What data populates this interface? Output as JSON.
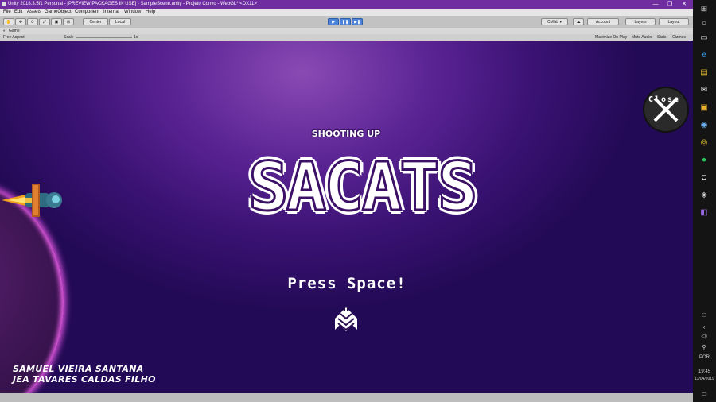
{
  "window": {
    "title": "Unity 2018.3.5f1 Personal - [PREVIEW PACKAGES IN USE] - SampleScene.unity - Projeto Convo - WebGL* <DX11>",
    "minimize": "—",
    "maximize": "❐",
    "close": "✕"
  },
  "menu": {
    "items": [
      "File",
      "Edit",
      "Assets",
      "GameObject",
      "Component",
      "Internal",
      "Window",
      "Help"
    ]
  },
  "toolbar": {
    "pivot": "Center",
    "space": "Local",
    "play": "▶",
    "pause": "❚❚",
    "step": "▶❚",
    "collab": "Collab ▾",
    "cloud": "☁",
    "account": "Account",
    "layers": "Layers",
    "layout": "Layout"
  },
  "game_panel": {
    "tab": "Game",
    "aspect": "Free Aspect",
    "scale_label": "Scale",
    "scale_value": "1x",
    "maximize_on_play": "Maximize On Play",
    "mute_audio": "Mute Audio",
    "stats": "Stats",
    "gizmos": "Gizmos"
  },
  "game": {
    "close_label": "Close",
    "subtitle": "SHOOTING UP",
    "logo": "SACATS",
    "prompt": "Press Space!",
    "credits": [
      "SAMUEL VIEIRA SANTANA",
      "JEA TAVARES CALDAS FILHO"
    ]
  },
  "taskbar": {
    "language": "POR",
    "time": "19:45",
    "date": "11/04/2019"
  },
  "colors": {
    "title_bar": "#6f2da0",
    "planet_glow": "#d34fd6",
    "game_bg": "#4a1a85"
  }
}
